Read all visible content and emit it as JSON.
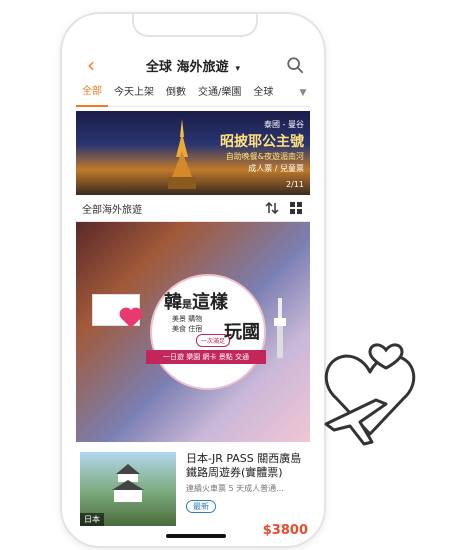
{
  "header": {
    "back_icon": "chevron-left-icon",
    "title": "全球 海外旅遊",
    "title_caret": "▾",
    "search_icon": "search-icon"
  },
  "tabs": [
    {
      "label": "全部",
      "active": true
    },
    {
      "label": "今天上架",
      "active": false
    },
    {
      "label": "倒數",
      "active": false
    },
    {
      "label": "交通/樂園",
      "active": false
    },
    {
      "label": "全球",
      "active": false
    }
  ],
  "tabs_more_icon": "▼",
  "banner": {
    "tag": "泰國 - 曼谷",
    "title": "昭披耶公主號",
    "subtitle": "自助晚餐&夜遊湄南河",
    "price_note": "成人票 / 兒童票",
    "page_indicator": "2/11"
  },
  "filterbar": {
    "label": "全部海外旅遊",
    "sort_icon": "sort-icon",
    "grid_icon": "grid-icon"
  },
  "feature": {
    "title_a": "韓",
    "title_small": "是",
    "title_b": "這樣",
    "line1": "美景 購物",
    "line2": "美食 住宿",
    "chip": "一次滿足",
    "title_c": "玩國",
    "strip": "一日遊 樂園 網卡 景點 交通"
  },
  "card": {
    "title": "日本-JR PASS 關西廣島鐵路周遊券(實體票)",
    "desc": "連續火車票 5 天成人普通...",
    "badge": "最新",
    "thumb_label": "日本",
    "price": "$3800"
  },
  "colors": {
    "accent": "#f47a20",
    "price": "#e94b2f",
    "badge": "#2d7cc4",
    "korean_pink": "#c3265a"
  }
}
